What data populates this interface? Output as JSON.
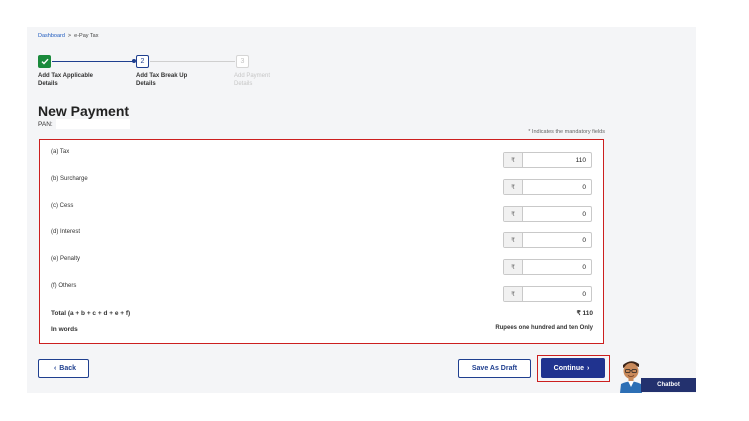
{
  "breadcrumb": {
    "home": "Dashboard",
    "separator": ">",
    "current": "e-Pay Tax"
  },
  "steps": [
    {
      "number": "",
      "label_line1": "Add Tax Applicable",
      "label_line2": "Details",
      "state": "completed"
    },
    {
      "number": "2",
      "label_line1": "Add Tax Break Up",
      "label_line2": "Details",
      "state": "active"
    },
    {
      "number": "3",
      "label_line1": "Add Payment",
      "label_line2": "Details",
      "state": "pending"
    }
  ],
  "page": {
    "title": "New Payment",
    "pan_label": "PAN:",
    "pan_value": "",
    "mandatory_note": "* Indicates the mandatory fields"
  },
  "form": {
    "currency_symbol": "₹",
    "rows": [
      {
        "label": "(a) Tax",
        "value": "110"
      },
      {
        "label": "(b) Surcharge",
        "value": "0"
      },
      {
        "label": "(c) Cess",
        "value": "0"
      },
      {
        "label": "(d) Interest",
        "value": "0"
      },
      {
        "label": "(e) Penalty",
        "value": "0"
      },
      {
        "label": "(f) Others",
        "value": "0"
      }
    ],
    "total_label": "Total (a + b + c + d + e + f)",
    "total_value": "₹ 110",
    "words_label": "In words",
    "words_value": "Rupees one hundred and ten Only"
  },
  "buttons": {
    "back": "Back",
    "back_icon": "‹",
    "save_draft": "Save As Draft",
    "continue": "Continue",
    "continue_icon": "›"
  },
  "chatbot": {
    "label": "Chatbot"
  },
  "colors": {
    "primary": "#20338f",
    "success": "#1a8a3c",
    "highlight": "#cc1f1f",
    "panel": "#f4f5f7"
  }
}
